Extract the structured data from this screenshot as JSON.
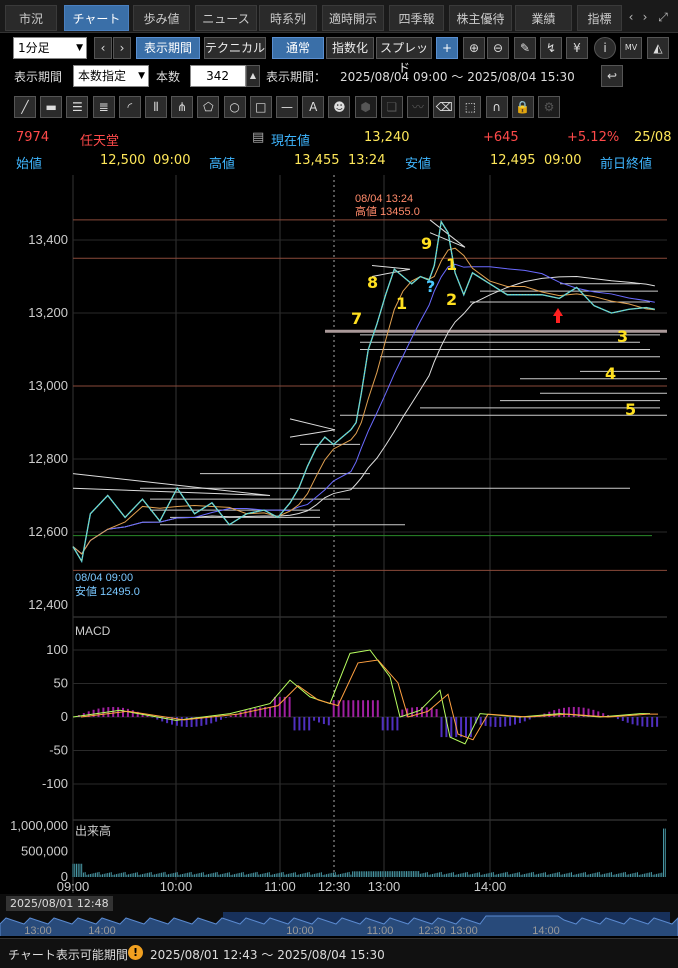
{
  "tabs": [
    {
      "label": "市況",
      "active": false
    },
    {
      "label": "チャート",
      "active": true
    },
    {
      "label": "歩み値",
      "active": false
    },
    {
      "label": "ニュース",
      "active": false
    },
    {
      "label": "時系列",
      "active": false
    },
    {
      "label": "適時開示",
      "active": false
    },
    {
      "label": "四季報",
      "active": false
    },
    {
      "label": "株主優待",
      "active": false
    },
    {
      "label": "業績",
      "active": false
    },
    {
      "label": "指標",
      "active": false
    }
  ],
  "toolbar": {
    "period_select": "1分足",
    "display_period_btn": "表示期間",
    "technical_btn": "テクニカル",
    "normal_btn": "通常",
    "index_btn": "指数化",
    "spread_btn": "スプレッド",
    "yen_icon": "¥",
    "info_icon": "i",
    "mv_icon": "MV"
  },
  "period_row": {
    "label": "表示期間",
    "mode_select": "本数指定",
    "count_label": "本数",
    "count_value": "342",
    "range_label": "表示期間：",
    "range_value": "2025/08/04 09:00 ～ 2025/08/04 15:30"
  },
  "tools": [
    "line",
    "ruler",
    "hlines",
    "hlines2",
    "fan",
    "vlines",
    "fork",
    "pentagon",
    "circle",
    "rect",
    "hline",
    "text",
    "icon",
    "stamp",
    "copy",
    "wave",
    "eraser",
    "select",
    "magnet",
    "lock",
    "gear"
  ],
  "tool_text": {
    "text": "A",
    "icon": "ICON"
  },
  "quote": {
    "code": "7974",
    "name": "任天堂",
    "current_label": "現在値",
    "current_value": "13,240",
    "change": "+645",
    "change_pct": "+5.12%",
    "date_trunc": "25/08",
    "open_label": "始値",
    "open_value": "12,500",
    "open_time": "09:00",
    "high_label": "高値",
    "high_value": "13,455",
    "high_time": "13:24",
    "low_label": "安値",
    "low_value": "12,495",
    "low_time": "09:00",
    "prev_label": "前日終値"
  },
  "colors": {
    "up": "#ff4a4a",
    "blue": "#3fb6ff",
    "yellow": "#ffe85a",
    "accent": "#3a6fa8"
  },
  "chart_data": {
    "type": "line",
    "y_ticks": [
      "13,400",
      "13,200",
      "13,000",
      "12,800",
      "12,600",
      "12,400"
    ],
    "ylim": [
      12400,
      13400
    ],
    "x_ticks": [
      "09:00",
      "10:00",
      "11:00",
      "12:30",
      "13:00",
      "14:00"
    ],
    "price": [
      [
        0,
        12560
      ],
      [
        5,
        12520
      ],
      [
        10,
        12650
      ],
      [
        20,
        12700
      ],
      [
        30,
        12640
      ],
      [
        40,
        12690
      ],
      [
        50,
        12630
      ],
      [
        60,
        12720
      ],
      [
        70,
        12650
      ],
      [
        80,
        12680
      ],
      [
        90,
        12620
      ],
      [
        100,
        12650
      ],
      [
        110,
        12660
      ],
      [
        118,
        12640
      ],
      [
        125,
        12680
      ],
      [
        130,
        12720
      ],
      [
        135,
        12780
      ],
      [
        140,
        12830
      ],
      [
        145,
        12860
      ],
      [
        150,
        12840
      ],
      [
        160,
        12880
      ],
      [
        163,
        12900
      ],
      [
        166,
        12980
      ],
      [
        170,
        13100
      ],
      [
        175,
        13170
      ],
      [
        180,
        13250
      ],
      [
        185,
        13320
      ],
      [
        190,
        13300
      ],
      [
        195,
        13280
      ],
      [
        200,
        13300
      ],
      [
        205,
        13290
      ],
      [
        208,
        13330
      ],
      [
        212,
        13450
      ],
      [
        216,
        13420
      ],
      [
        220,
        13310
      ],
      [
        225,
        13250
      ],
      [
        230,
        13310
      ],
      [
        240,
        13280
      ],
      [
        250,
        13250
      ],
      [
        260,
        13250
      ],
      [
        270,
        13250
      ],
      [
        280,
        13240
      ],
      [
        290,
        13270
      ],
      [
        300,
        13220
      ],
      [
        310,
        13200
      ],
      [
        320,
        13210
      ],
      [
        330,
        13215
      ],
      [
        335,
        13210
      ]
    ],
    "annotations": {
      "high_date": "08/04 13:24",
      "high_text": "高値 13455.0",
      "low_date": "08/04 09:00",
      "low_text": "安値 12495.0",
      "counts": [
        "9",
        "8",
        "7",
        "1",
        "2",
        "1",
        "3",
        "4",
        "5",
        "?"
      ]
    },
    "macd": {
      "label": "MACD",
      "y_ticks": [
        "100",
        "50",
        "0",
        "-50",
        "-100"
      ],
      "ylim": [
        -100,
        100
      ]
    },
    "volume": {
      "label": "出来高",
      "y_ticks": [
        "1,000,000",
        "500,000",
        "0"
      ]
    }
  },
  "navigator": {
    "start_label": "2025/08/01 12:48",
    "ticks": [
      "13:00",
      "14:00",
      "10:00",
      "11:00",
      "12:30",
      "13:00",
      "14:00"
    ]
  },
  "footer": {
    "label": "チャート表示可能期間",
    "warn_icon": "!",
    "range": "2025/08/01 12:43 ～ 2025/08/04 15:30"
  }
}
